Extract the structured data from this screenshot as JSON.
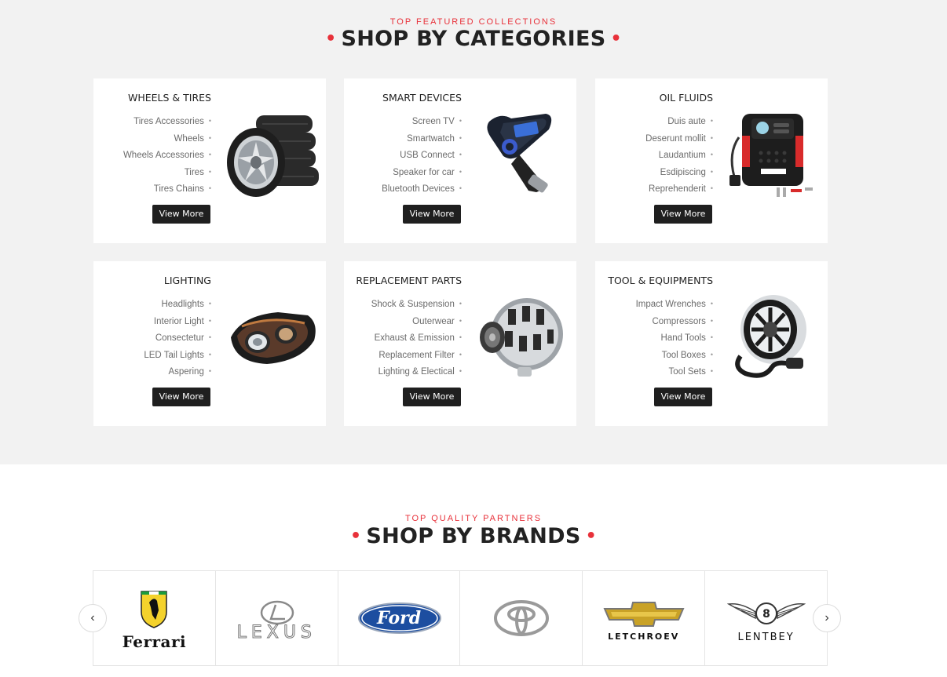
{
  "categories_section": {
    "eyebrow": "TOP FEATURED COLLECTIONS",
    "title": "SHOP BY CATEGORIES",
    "cards": [
      {
        "title": "WHEELS & TIRES",
        "items": [
          "Tires Accessories",
          "Wheels",
          "Wheels Accessories",
          "Tires",
          "Tires Chains"
        ],
        "button": "View More",
        "image": "tires-image"
      },
      {
        "title": "SMART DEVICES",
        "items": [
          "Screen TV",
          "Smartwatch",
          "USB Connect",
          "Speaker for car",
          "Bluetooth Devices"
        ],
        "button": "View More",
        "image": "fm-transmitter-image"
      },
      {
        "title": "OIL FLUIDS",
        "items": [
          "Duis aute",
          "Deserunt mollit",
          "Laudantium",
          "Esdipiscing",
          "Reprehenderit"
        ],
        "button": "View More",
        "image": "air-compressor-image"
      },
      {
        "title": "LIGHTING",
        "items": [
          "Headlights",
          "Interior Light",
          "Consectetur",
          "LED Tail Lights",
          "Aspering"
        ],
        "button": "View More",
        "image": "headlight-image"
      },
      {
        "title": "REPLACEMENT PARTS",
        "items": [
          "Shock & Suspension",
          "Outerwear",
          "Exhaust & Emission",
          "Replacement Filter",
          "Lighting & Electical"
        ],
        "button": "View More",
        "image": "alternator-image"
      },
      {
        "title": "TOOL & EQUIPMENTS",
        "items": [
          "Impact Wrenches",
          "Compressors",
          "Hand Tools",
          "Tool Boxes",
          "Tool Sets"
        ],
        "button": "View More",
        "image": "speaker-image"
      }
    ]
  },
  "brands_section": {
    "eyebrow": "TOP QUALITY PARTNERS",
    "title": "SHOP BY BRANDS",
    "brands": [
      "Ferrari",
      "LEXUS",
      "Ford",
      "Toyota",
      "LETCHROEV",
      "LENTBEY"
    ],
    "prev_icon": "chevron-left-icon",
    "next_icon": "chevron-right-icon"
  },
  "colors": {
    "accent": "#e8313a",
    "dark": "#1f1f1f",
    "section_bg": "#f2f2f2"
  }
}
